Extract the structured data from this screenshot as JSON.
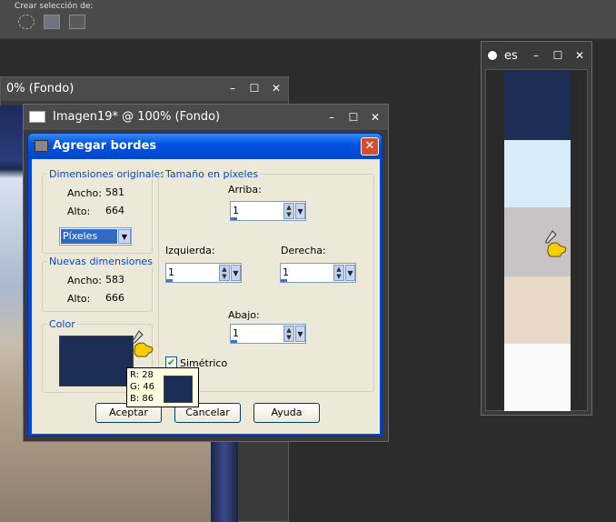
{
  "toolbar": {
    "label": "Crear selección de:",
    "icons": [
      "selection-dashed-icon",
      "selection-rect-icon",
      "selection-layer-icon"
    ]
  },
  "bg_window": {
    "title": "0% (Fondo)"
  },
  "image_window": {
    "title": "Imagen19* @ 100% (Fondo)"
  },
  "dialog": {
    "title": "Agregar bordes",
    "close_label": "✕",
    "original_group": {
      "title": "Dimensiones originales",
      "width_label": "Ancho:",
      "width_value": "581",
      "height_label": "Alto:",
      "height_value": "664"
    },
    "units_select": "Píxeles",
    "new_group": {
      "title": "Nuevas dimensiones",
      "width_label": "Ancho:",
      "width_value": "583",
      "height_label": "Alto:",
      "height_value": "666"
    },
    "color_group": {
      "title": "Color",
      "swatch_color": "#1c2e56"
    },
    "pixel_group": {
      "title": "Tamaño en píxeles",
      "top_label": "Arriba:",
      "top_value": "1",
      "left_label": "Izquierda:",
      "left_value": "1",
      "right_label": "Derecha:",
      "right_value": "1",
      "bottom_label": "Abajo:",
      "bottom_value": "1",
      "symmetric_label": "Simétrico",
      "symmetric_checked": true
    },
    "buttons": {
      "accept": "Aceptar",
      "cancel": "Cancelar",
      "help": "Ayuda"
    }
  },
  "tooltip": {
    "r": "R: 28",
    "g": "G: 46",
    "b": "B: 86",
    "color": "#1c2e56"
  },
  "palette_window": {
    "title": "es",
    "swatches": [
      "#1c2e56",
      "#d7ecfa",
      "#c8c4c6",
      "#e8d8c8",
      "#fafafa"
    ]
  }
}
